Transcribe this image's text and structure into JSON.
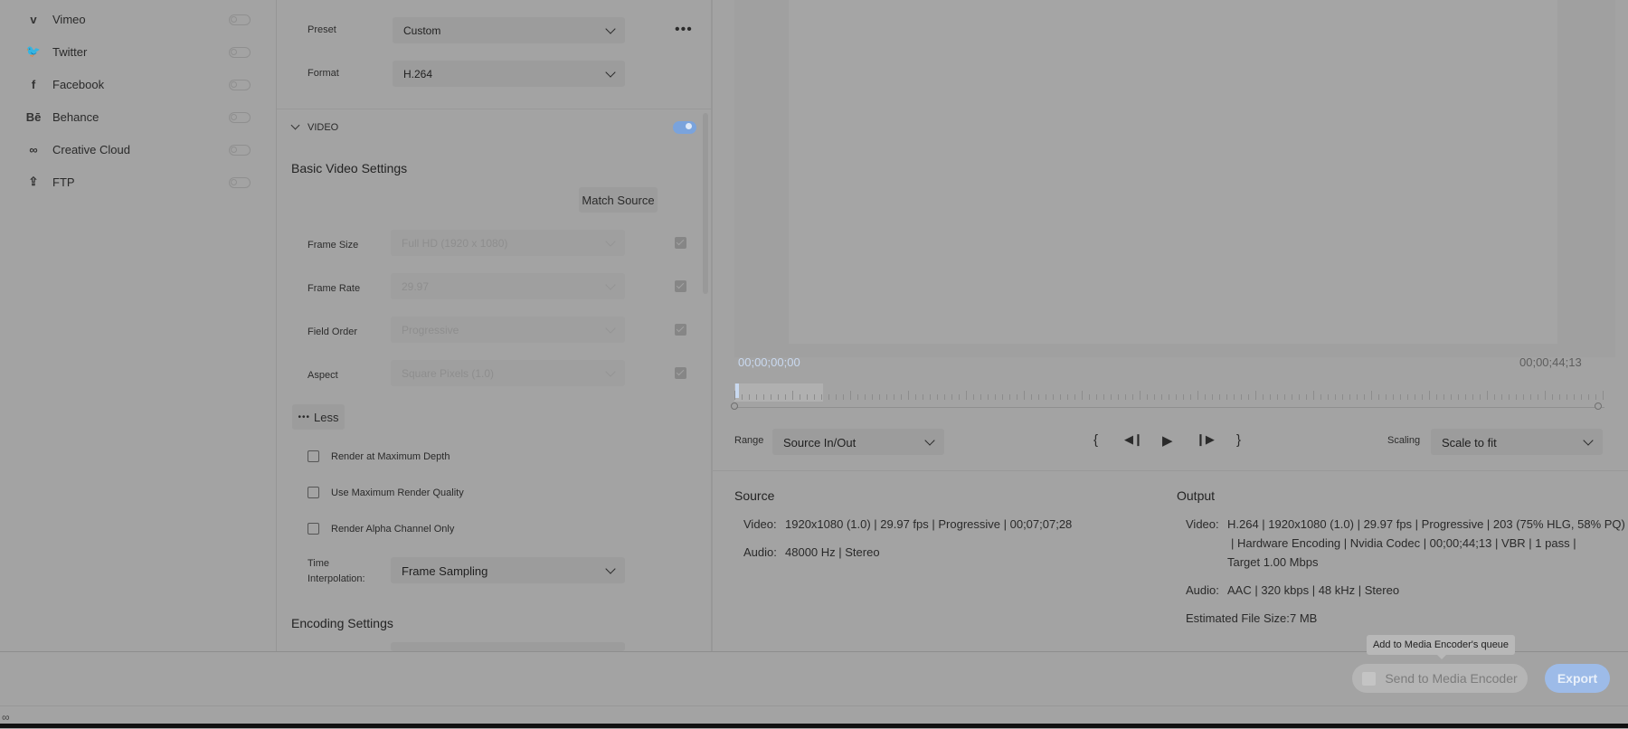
{
  "destinations": [
    {
      "label": "Vimeo",
      "icon": "vimeo-icon",
      "glyph": "v",
      "on": false
    },
    {
      "label": "Twitter",
      "icon": "twitter-icon",
      "glyph": "🐦",
      "on": false
    },
    {
      "label": "Facebook",
      "icon": "facebook-icon",
      "glyph": "f",
      "on": false
    },
    {
      "label": "Behance",
      "icon": "behance-icon",
      "glyph": "Bē",
      "on": false
    },
    {
      "label": "Creative Cloud",
      "icon": "creative-cloud-icon",
      "glyph": "∞",
      "on": false
    },
    {
      "label": "FTP",
      "icon": "upload-icon",
      "glyph": "⇪",
      "on": false
    }
  ],
  "settings": {
    "preset_label": "Preset",
    "preset_value": "Custom",
    "format_label": "Format",
    "format_value": "H.264",
    "video_section": "VIDEO",
    "basic_video_title": "Basic Video Settings",
    "match_source": "Match Source",
    "frame_size_label": "Frame Size",
    "frame_size_value": "Full HD (1920 x 1080)",
    "frame_rate_label": "Frame Rate",
    "frame_rate_value": "29.97",
    "field_order_label": "Field Order",
    "field_order_value": "Progressive",
    "aspect_label": "Aspect",
    "aspect_value": "Square Pixels (1.0)",
    "less_label": "Less",
    "render_max_depth": "Render at Maximum Depth",
    "max_render_quality": "Use Maximum Render Quality",
    "render_alpha": "Render Alpha Channel Only",
    "time_interp_label_1": "Time",
    "time_interp_label_2": "Interpolation:",
    "time_interp_value": "Frame Sampling",
    "encoding_title": "Encoding Settings"
  },
  "preview": {
    "timecode_start": "00;00;00;00",
    "timecode_end": "00;00;44;13",
    "range_label": "Range",
    "range_value": "Source In/Out",
    "scaling_label": "Scaling",
    "scaling_value": "Scale to fit"
  },
  "source": {
    "title": "Source",
    "video_label": "Video:",
    "video_value": "1920x1080 (1.0)  |  29.97 fps  |  Progressive  |  00;07;07;28",
    "audio_label": "Audio:",
    "audio_value": "48000 Hz  |  Stereo"
  },
  "output": {
    "title": "Output",
    "video_label": "Video:",
    "video_line1": "H.264  |  1920x1080 (1.0)  |  29.97 fps  |  Progressive  |  203 (75% HLG, 58% PQ)",
    "video_line2": "|  Hardware Encoding  |  Nvidia Codec  |  00;00;44;13   |  VBR  |  1 pass  |",
    "video_line3": "Target 1.00 Mbps",
    "audio_label": "Audio:",
    "audio_value": "AAC  |  320 kbps  |  48 kHz  |  Stereo",
    "size_label": "Estimated File Size:",
    "size_value": "7 MB"
  },
  "footer": {
    "tooltip": "Add to Media Encoder's queue",
    "send_label": "Send to Media Encoder",
    "export_label": "Export"
  },
  "colors": {
    "accent": "#7aa3dc",
    "background": "#a3a3a3"
  }
}
